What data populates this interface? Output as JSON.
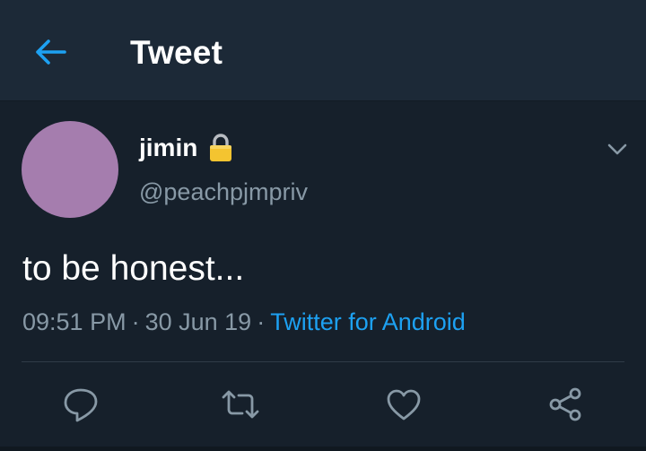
{
  "header": {
    "title": "Tweet",
    "back_icon": "arrow-left-icon"
  },
  "tweet": {
    "display_name": "jimin",
    "protected_icon": "lock-icon",
    "handle": "@peachpjmpriv",
    "text": "to be honest...",
    "time": "09:51 PM",
    "date": "30 Jun 19",
    "separator": "·",
    "source": "Twitter for Android",
    "caret_icon": "chevron-down-icon"
  },
  "actions": {
    "reply_icon": "reply-icon",
    "retweet_icon": "retweet-icon",
    "like_icon": "heart-icon",
    "share_icon": "share-icon"
  },
  "colors": {
    "background": "#16202b",
    "header_background": "#1c2937",
    "accent": "#1da1f2",
    "secondary_text": "#8899a6",
    "avatar": "#a57dae"
  }
}
